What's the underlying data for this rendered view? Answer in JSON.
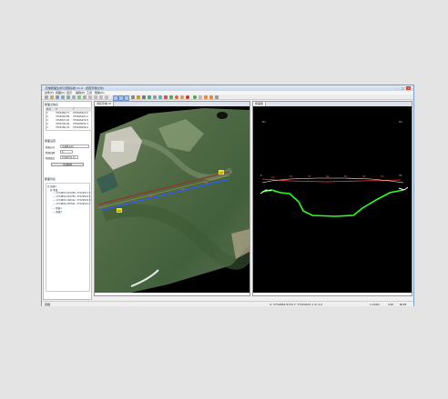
{
  "window": {
    "title": "影像断面生成与测量系统 V1.0 - [测区影像文件]"
  },
  "menu": [
    "文件(F)",
    "视图(V)",
    "显示",
    "编辑(E)",
    "工具",
    "帮助(H)"
  ],
  "left_panel": {
    "section1_title": "断面点信息",
    "grid_headers": [
      "序号",
      "X",
      "Y"
    ],
    "grid_rows": [
      [
        "1",
        "3754482.77",
        "375295413.5"
      ],
      [
        "2",
        "3754563.89",
        "375295447.2"
      ],
      [
        "3",
        "3754621.30",
        "375295474.8"
      ],
      [
        "4",
        "3754702.46",
        "375295501.3"
      ],
      [
        "5",
        "3754760.32",
        "375295526.9"
      ]
    ],
    "section2_title": "断面设置",
    "line_label": "断面方向",
    "line_value": "沿线路方向",
    "spacing_label": "断面间隔",
    "spacing_value": "5",
    "width_label": "断面宽度",
    "width_value": "0.5007m·m",
    "generate_button": "生成断面",
    "section3_title": "断面列表",
    "tree_items": [
      "日 线路1",
      "日 断面",
      "— 1754863.972048, 37229517.4",
      "— 1754862.614785, 37229519.5",
      "— 1754863.108412, 37229520.8",
      "— 1754864.287561, 37229521.7",
      "— 断面1",
      "— 断面2"
    ]
  },
  "left_view": {
    "tab_label": "测区影像.tif",
    "markers": [
      "A1",
      "A2"
    ],
    "measure_labels": [
      "41",
      "22",
      "48"
    ]
  },
  "right_view": {
    "tab_label": "断面图",
    "corner_left": "B1",
    "corner_right": "B2",
    "ground_labels": [
      "10",
      "20",
      "30",
      "40",
      "50",
      "60",
      "70"
    ],
    "end_labels": [
      "0",
      "75"
    ]
  },
  "status": {
    "left": "就绪",
    "coords": "X: 3754863.9724  Y: 37229521.1  Z: 0.0",
    "scale": "1:2000",
    "cap": "CAP",
    "num": "NUM"
  },
  "colors": {
    "profile_red": "#ff3b3b",
    "ground_green": "#2cff1f",
    "marker_yellow": "#f2e600",
    "selection_blue": "#2a5bff"
  }
}
